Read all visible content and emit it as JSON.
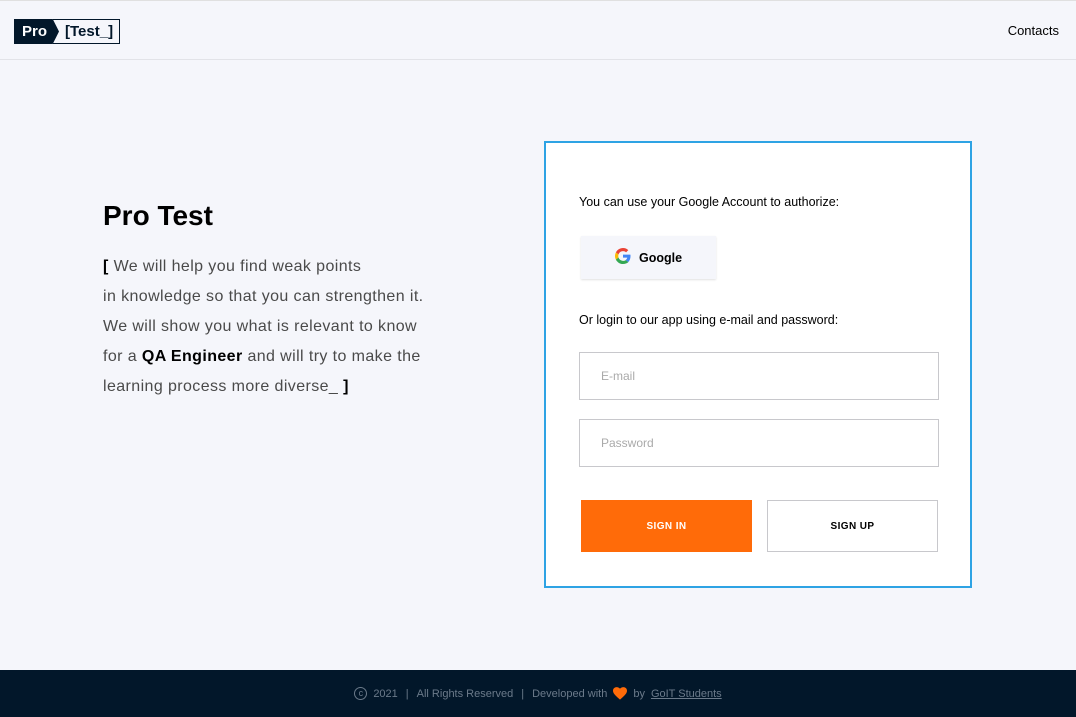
{
  "header": {
    "logo_left": "Pro",
    "logo_right": "[Test_]",
    "contacts_label": "Contacts"
  },
  "intro": {
    "title": "Pro Test",
    "open_bracket": "[",
    "line1": " We will help you find weak points",
    "line2": "in knowledge so that you can strengthen it.",
    "line3": "We will show you what is relevant to know",
    "line4_pre": "for a ",
    "line4_bold": "QA Engineer",
    "line4_post": " and will try to make the",
    "line5": "learning process more diverse_ ",
    "close_bracket": "]"
  },
  "login": {
    "google_prompt": "You can use your Google Account to authorize:",
    "google_button": "Google",
    "email_prompt": "Or login to our app using e-mail and password:",
    "email_placeholder": "E-mail",
    "email_value": "",
    "password_placeholder": "Password",
    "password_value": "",
    "sign_in": "SIGN IN",
    "sign_up": "SIGN UP"
  },
  "footer": {
    "copyright_symbol": "c",
    "year": "2021",
    "separator": "|",
    "rights": "All Rights Reserved",
    "developed": "Developed with",
    "by": "by",
    "team": "GoIT Students"
  },
  "colors": {
    "accent": "#ff6b09",
    "card_border": "#2ea3e4",
    "dark": "#02172a",
    "background": "#f5f6fb"
  },
  "icons": {
    "google": "google-g-icon",
    "heart": "heart-icon",
    "copyright": "copyright-icon"
  }
}
